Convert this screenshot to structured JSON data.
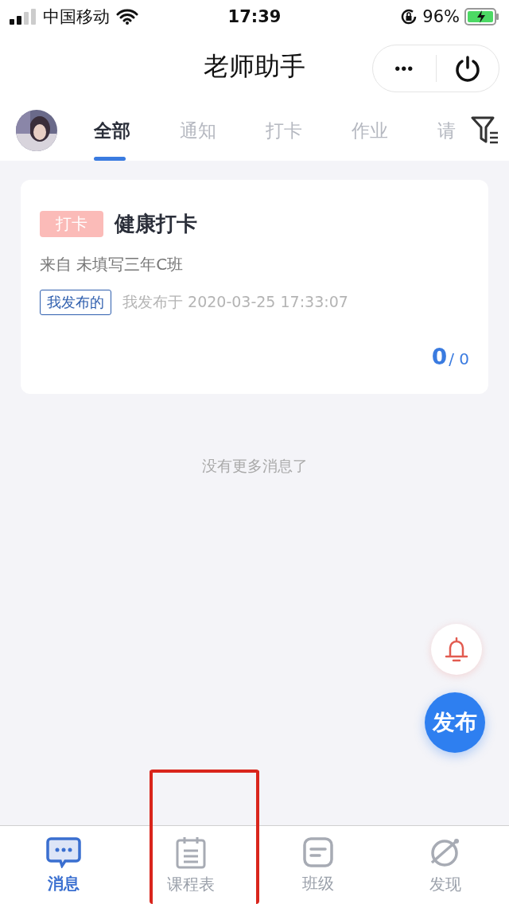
{
  "status_bar": {
    "carrier": "中国移动",
    "time": "17:39",
    "battery": "96%"
  },
  "header": {
    "title": "老师助手",
    "more": "•••"
  },
  "tabs": [
    {
      "label": "全部",
      "selected": true
    },
    {
      "label": "通知",
      "selected": false
    },
    {
      "label": "打卡",
      "selected": false
    },
    {
      "label": "作业",
      "selected": false
    },
    {
      "label": "请",
      "selected": false
    }
  ],
  "cards": [
    {
      "tag": "打卡",
      "title": "健康打卡",
      "source": "来自 未填写三年C班",
      "badge": "我发布的",
      "published": "我发布于 2020-03-25 17:33:07",
      "done": "0",
      "total": "/ 0"
    }
  ],
  "empty_note": "没有更多消息了",
  "fab": {
    "label": "发布"
  },
  "bottom_nav": [
    {
      "label": "消息",
      "selected": true,
      "annotated": false
    },
    {
      "label": "课程表",
      "selected": false,
      "annotated": true
    },
    {
      "label": "班级",
      "selected": false,
      "annotated": false
    },
    {
      "label": "发现",
      "selected": false,
      "annotated": false
    }
  ]
}
